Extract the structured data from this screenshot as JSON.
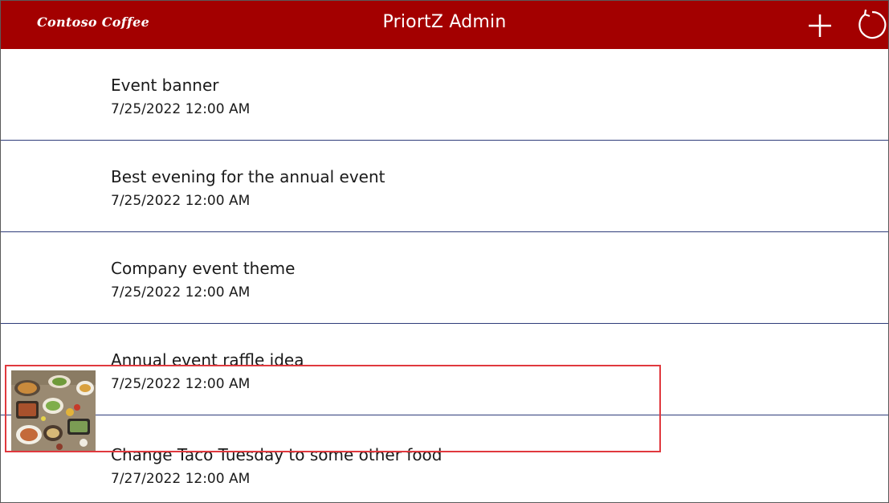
{
  "header": {
    "logo": "Contoso Coffee",
    "title": "PriortZ Admin",
    "add_icon": "plus-icon",
    "refresh_icon": "refresh-icon",
    "background": "#a30000"
  },
  "items": [
    {
      "title": "Event banner",
      "date": "7/25/2022 12:00 AM"
    },
    {
      "title": "Best evening for the annual event",
      "date": "7/25/2022 12:00 AM"
    },
    {
      "title": "Company event theme",
      "date": "7/25/2022 12:00 AM"
    },
    {
      "title": "Annual event raffle idea",
      "date": "7/25/2022 12:00 AM"
    },
    {
      "title": "Change Taco Tuesday to some other food",
      "date": "7/27/2022 12:00 AM",
      "image": "food-photo"
    }
  ],
  "colors": {
    "divider": "#2e3c7a",
    "highlight": "#e0393e"
  }
}
